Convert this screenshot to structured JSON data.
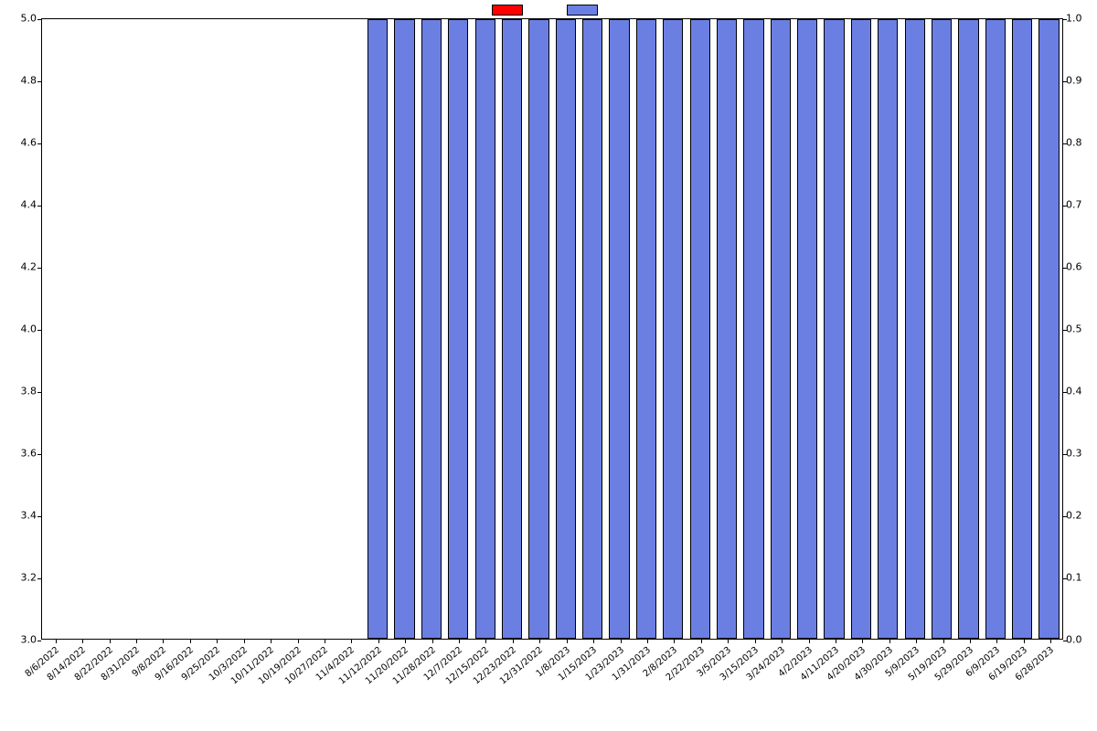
{
  "chart_data": {
    "type": "bar",
    "categories": [
      "8/6/2022",
      "8/14/2022",
      "8/22/2022",
      "8/31/2022",
      "9/8/2022",
      "9/16/2022",
      "9/25/2022",
      "10/3/2022",
      "10/11/2022",
      "10/19/2022",
      "10/27/2022",
      "11/4/2022",
      "11/12/2022",
      "11/20/2022",
      "11/28/2022",
      "12/7/2022",
      "12/15/2022",
      "12/23/2022",
      "12/31/2022",
      "1/8/2023",
      "1/15/2023",
      "1/23/2023",
      "1/31/2023",
      "2/8/2023",
      "2/22/2023",
      "3/5/2023",
      "3/15/2023",
      "3/24/2023",
      "4/2/2023",
      "4/11/2023",
      "4/20/2023",
      "4/30/2023",
      "5/9/2023",
      "5/19/2023",
      "5/29/2023",
      "6/9/2023",
      "6/19/2023",
      "6/28/2023"
    ],
    "series": [
      {
        "name": "",
        "axis": "left",
        "color": "#ff0000",
        "values": [
          null,
          null,
          null,
          null,
          null,
          null,
          null,
          null,
          null,
          null,
          null,
          null,
          null,
          null,
          null,
          null,
          null,
          null,
          null,
          null,
          null,
          null,
          null,
          null,
          null,
          null,
          null,
          null,
          null,
          null,
          null,
          null,
          null,
          null,
          null,
          null,
          null,
          null
        ]
      },
      {
        "name": "",
        "axis": "right",
        "color": "#6b7fe3",
        "values": [
          0,
          0,
          0,
          0,
          0,
          0,
          0,
          0,
          0,
          0,
          0,
          0,
          1,
          1,
          1,
          1,
          1,
          1,
          1,
          1,
          1,
          1,
          1,
          1,
          1,
          1,
          1,
          1,
          1,
          1,
          1,
          1,
          1,
          1,
          1,
          1,
          1,
          1
        ]
      }
    ],
    "title": "",
    "xlabel": "",
    "y_left": {
      "label": "",
      "lim": [
        3.0,
        5.0
      ],
      "ticks": [
        3.0,
        3.2,
        3.4,
        3.6,
        3.8,
        4.0,
        4.2,
        4.4,
        4.6,
        4.8,
        5.0
      ]
    },
    "y_right": {
      "label": "",
      "lim": [
        0.0,
        1.0
      ],
      "ticks": [
        0.0,
        0.1,
        0.2,
        0.3,
        0.4,
        0.5,
        0.6,
        0.7,
        0.8,
        0.9,
        1.0
      ]
    }
  },
  "legend": {
    "items": [
      {
        "label": "",
        "color": "#ff0000"
      },
      {
        "label": "",
        "color": "#6b7fe3"
      }
    ]
  }
}
